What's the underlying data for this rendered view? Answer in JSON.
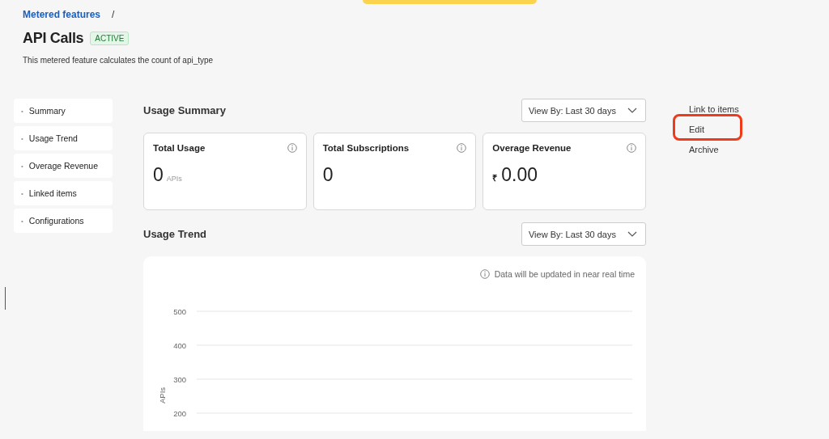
{
  "breadcrumb": {
    "link": "Metered features",
    "separator": "/"
  },
  "title": "API Calls",
  "status_badge": "ACTIVE",
  "description": "This metered feature calculates the count of api_type",
  "sidebar": {
    "items": [
      {
        "label": "Summary",
        "bullet": "•"
      },
      {
        "label": "Usage Trend",
        "bullet": "•"
      },
      {
        "label": "Overage Revenue",
        "bullet": "•"
      },
      {
        "label": "Linked items",
        "bullet": "•"
      },
      {
        "label": "Configurations",
        "bullet": "•"
      }
    ]
  },
  "usage_summary": {
    "heading": "Usage Summary",
    "view_by": "View By: Last 30 days",
    "cards": [
      {
        "title": "Total Usage",
        "value": "0",
        "unit": "APIs"
      },
      {
        "title": "Total Subscriptions",
        "value": "0"
      },
      {
        "title": "Overage Revenue",
        "currency": "₹",
        "value": "0.00"
      }
    ]
  },
  "usage_trend": {
    "heading": "Usage Trend",
    "view_by": "View By: Last 30 days",
    "note": "Data will be updated in near real time",
    "chart": {
      "axis_label": "APIs",
      "tick_labels": [
        "500",
        "400",
        "300",
        "200"
      ]
    }
  },
  "actions": [
    {
      "label": "Link to items",
      "highlighted": false
    },
    {
      "label": "Edit",
      "highlighted": true
    },
    {
      "label": "Archive",
      "highlighted": false
    }
  ]
}
